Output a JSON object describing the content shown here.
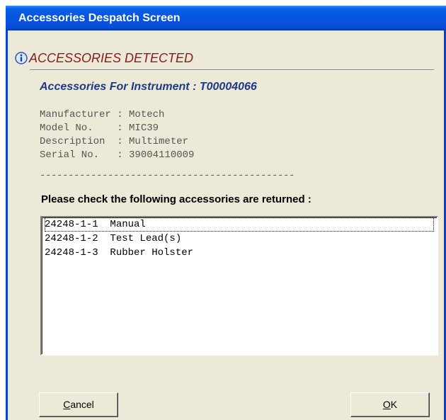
{
  "window": {
    "title": "Accessories Despatch Screen"
  },
  "header": {
    "heading": "ACCESSORIES DETECTED",
    "sub_heading": "Accessories For Instrument : T00004066"
  },
  "instrument": {
    "manufacturer": "Manufacturer : Motech",
    "model": "Model No.    : MIC39",
    "description": "Description  : Multimeter",
    "serial": "Serial No.   : 39004110009",
    "divider": "---------------------------------------------"
  },
  "prompt": "Please check the following accessories are returned :",
  "accessories": [
    {
      "code": "24248-1-1",
      "name": "Manual",
      "text": "24248-1-1  Manual"
    },
    {
      "code": "24248-1-2",
      "name": "Test Lead(s)",
      "text": "24248-1-2  Test Lead(s)"
    },
    {
      "code": "24248-1-3",
      "name": "Rubber Holster",
      "text": "24248-1-3  Rubber Holster"
    }
  ],
  "buttons": {
    "cancel_accel": "C",
    "cancel_rest": "ancel",
    "ok_accel": "O",
    "ok_rest": "K"
  },
  "icons": {
    "info": "info-icon"
  },
  "colors": {
    "titlebar": "#0a5fe8",
    "heading": "#8b1a1a",
    "sub_heading": "#1f3a86",
    "divider": "#2a58c8",
    "dialog_bg": "#ece9d8"
  }
}
